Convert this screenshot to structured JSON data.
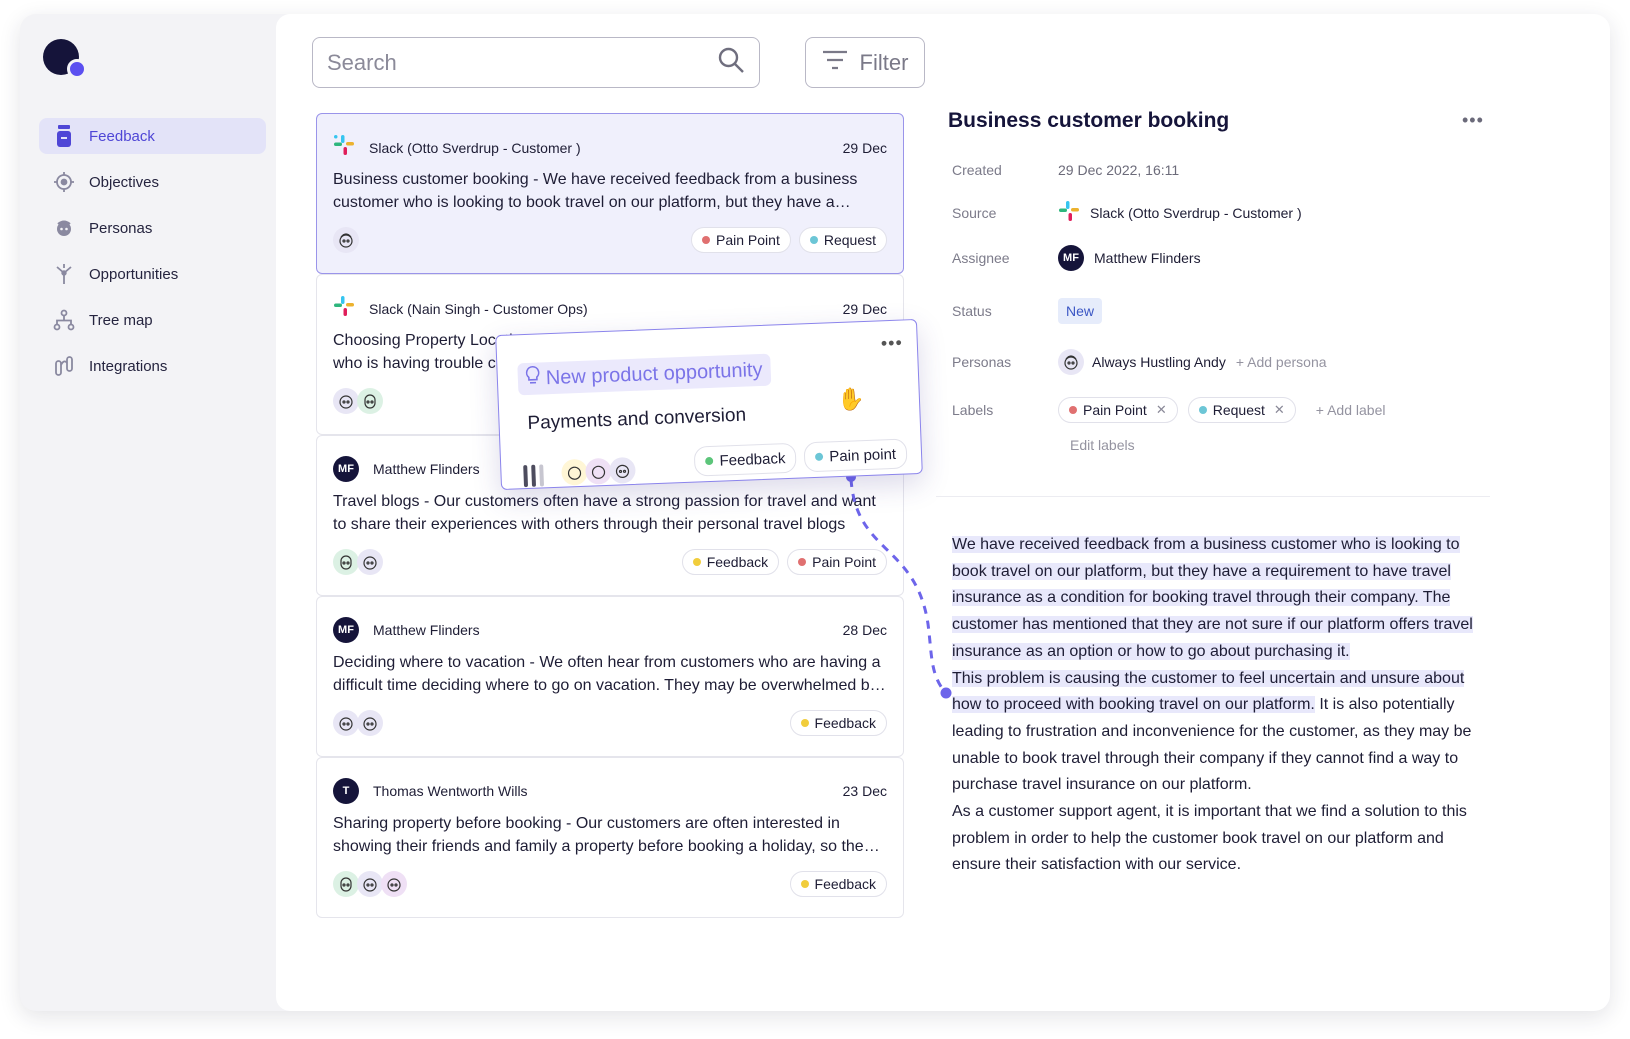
{
  "sidebar": {
    "items": [
      {
        "label": "Feedback",
        "icon": "feedback-icon"
      },
      {
        "label": "Objectives",
        "icon": "target-icon"
      },
      {
        "label": "Personas",
        "icon": "persona-icon"
      },
      {
        "label": "Opportunities",
        "icon": "branch-icon"
      },
      {
        "label": "Tree map",
        "icon": "tree-map-icon"
      },
      {
        "label": "Integrations",
        "icon": "integrations-icon"
      }
    ]
  },
  "toolbar": {
    "search_placeholder": "Search",
    "filter_label": "Filter"
  },
  "feedback_list": [
    {
      "source": "Slack (Otto Sverdrup - Customer )",
      "date": "29 Dec",
      "text": "Business customer booking - We have received feedback from a business customer who is looking to book travel on our platform, but they have a requirement to have travel insurance",
      "tags": [
        "Pain Point",
        "Request"
      ]
    },
    {
      "source": "Slack (Nain Singh - Customer Ops)",
      "date": "29 Dec",
      "text": "Choosing Property Location - We have received feedback from a customer who is having trouble choosing a property location",
      "tags": []
    },
    {
      "source": "Matthew Flinders",
      "date": "",
      "text": "Travel blogs - Our customers often have a strong passion for travel and want to share their experiences with others through their personal travel blogs",
      "tags": [
        "Feedback",
        "Pain Point"
      ]
    },
    {
      "source": "Matthew Flinders",
      "date": "28 Dec",
      "text": "Deciding where to vacation - We often hear from customers who are having a difficult time deciding where to go on vacation. They may be overwhelmed by choice",
      "tags": [
        "Feedback"
      ]
    },
    {
      "source": "Thomas Wentworth Wills",
      "date": "23 Dec",
      "text": "Sharing property before booking - Our customers are often interested in showing their friends and family a property before booking a holiday, so they can decide together",
      "tags": [
        "Feedback"
      ]
    }
  ],
  "avatar_initials": {
    "mf": "MF",
    "t": "T"
  },
  "popover": {
    "type_label": "New product opportunity",
    "title": "Payments and conversion",
    "tags": [
      "Feedback",
      "Pain point"
    ]
  },
  "detail": {
    "title": "Business customer booking",
    "fields": {
      "created_label": "Created",
      "created": "29 Dec 2022, 16:11",
      "source_label": "Source",
      "source": "Slack (Otto Sverdrup - Customer )",
      "assignee_label": "Assignee",
      "assignee": "Matthew Flinders",
      "status_label": "Status",
      "status": "New",
      "personas_label": "Personas",
      "persona": "Always Hustling Andy",
      "add_persona": "+ Add persona",
      "labels_label": "Labels",
      "labels": [
        "Pain Point",
        "Request"
      ],
      "add_label": "+ Add label",
      "edit_labels": "Edit labels"
    },
    "description": {
      "highlight_1": "We have received feedback from a business customer who is looking to book travel on our platform, but they have a requirement to have travel insurance as a condition for booking travel through their company. The customer has mentioned that they are not sure if our platform offers travel insurance as an option or how to go about purchasing it.",
      "highlight_2": "This problem is causing the customer to feel uncertain and unsure about how to proceed with booking travel on our platform.",
      "rest_2": " It is also potentially leading to frustration and inconvenience for the customer, as they may be unable to book travel through their company if they cannot find a way to purchase travel insurance on our platform.",
      "para_3": "As a customer support agent, it is important that we find a solution to this problem in order to help the customer book travel on our platform and ensure their satisfaction with our service."
    }
  },
  "colors": {
    "accent": "#4f46d6",
    "navy": "#15143a",
    "pain_point": "#e07070",
    "request": "#6cc6d6",
    "feedback_yellow": "#f1cd3c",
    "feedback_green": "#5cc57a",
    "highlight": "#e8e8fb"
  }
}
